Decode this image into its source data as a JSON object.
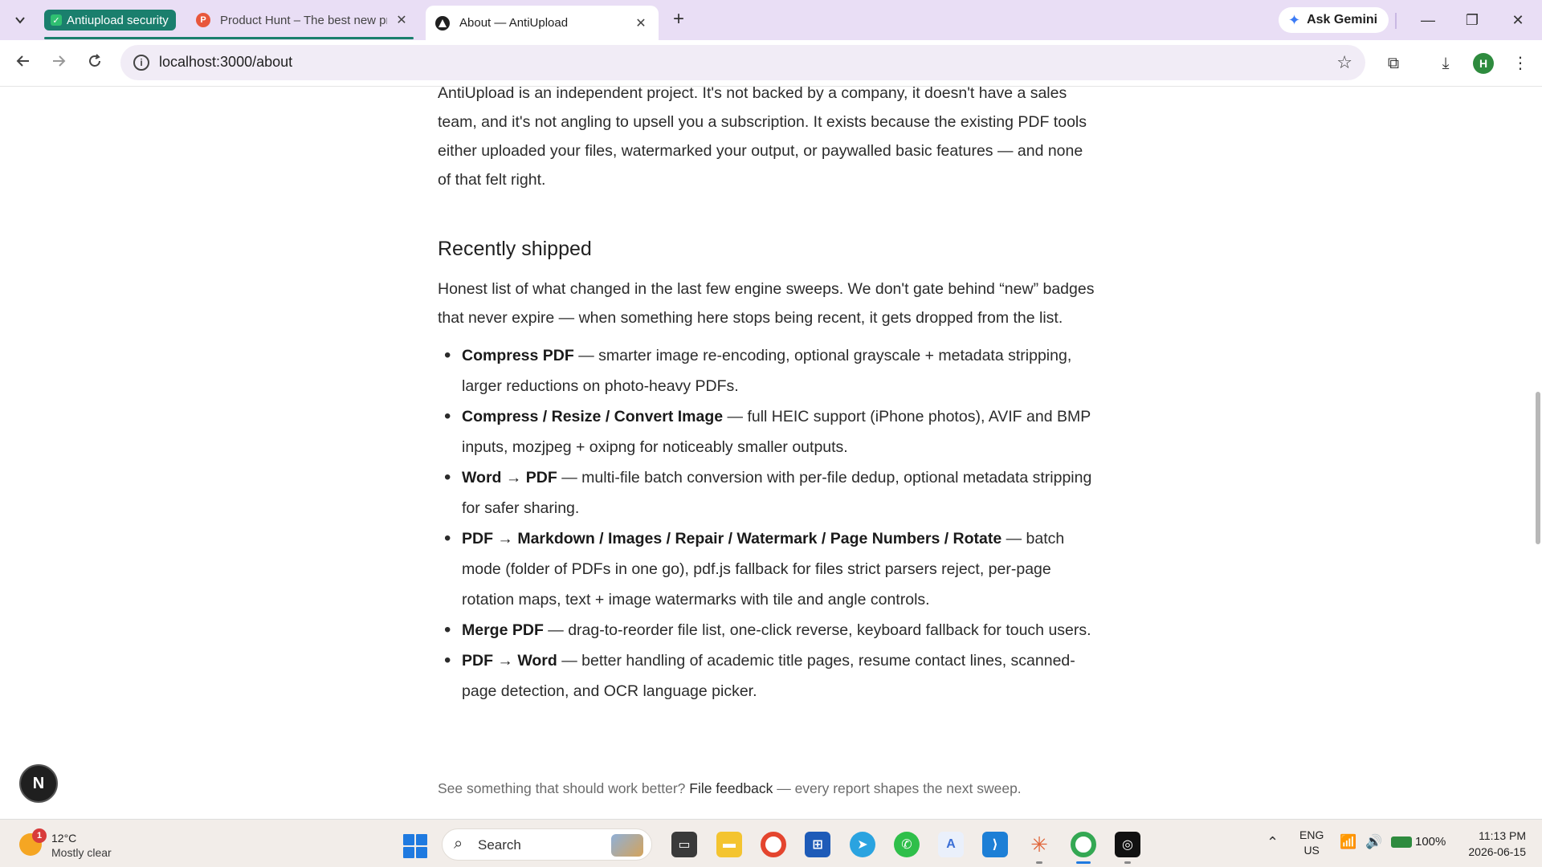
{
  "browser": {
    "tab_group_label": "Antiupload security",
    "tabs": [
      {
        "title": "Product Hunt – The best new products",
        "favicon": "P"
      },
      {
        "title": "About — AntiUpload",
        "active": true
      }
    ],
    "ask_gemini": "Ask Gemini",
    "url": "localhost:3000/about",
    "profile_initial": "H"
  },
  "page": {
    "intro": "AntiUpload is an independent project. It's not backed by a company, it doesn't have a sales team, and it's not angling to upsell you a subscription. It exists because the existing PDF tools either uploaded your files, watermarked your output, or paywalled basic features — and none of that felt right.",
    "section_title": "Recently shipped",
    "section_intro": "Honest list of what changed in the last few engine sweeps. We don't gate behind “new” badges that never expire — when something here stops being recent, it gets dropped from the list.",
    "items": [
      {
        "title": "Compress PDF",
        "desc": " — smarter image re-encoding, optional grayscale + metadata stripping, larger reductions on photo-heavy PDFs."
      },
      {
        "title": "Compress / Resize / Convert Image",
        "desc": " — full HEIC support (iPhone photos), AVIF and BMP inputs, mozjpeg + oxipng for noticeably smaller outputs."
      },
      {
        "title": "Word → PDF",
        "desc": " — multi-file batch conversion with per-file dedup, optional metadata stripping for safer sharing."
      },
      {
        "title": "PDF → Markdown / Images / Repair / Watermark / Page Numbers / Rotate",
        "desc": " — batch mode (folder of PDFs in one go), pdf.js fallback for files strict parsers reject, per-page rotation maps, text + image watermarks with tile and angle controls."
      },
      {
        "title": "Merge PDF",
        "desc": " — drag-to-reorder file list, one-click reverse, keyboard fallback for touch users."
      },
      {
        "title": "PDF → Word",
        "desc": " — better handling of academic title pages, resume contact lines, scanned-page detection, and OCR language picker."
      }
    ],
    "feedback_prefix": "See something that should work better? ",
    "feedback_link": "File feedback",
    "feedback_suffix": " — every report shapes the next sweep.",
    "fab_label": "N"
  },
  "taskbar": {
    "weather_badge": "1",
    "temperature": "12°C",
    "condition": "Mostly clear",
    "search_label": "Search",
    "lang_line1": "ENG",
    "lang_line2": "US",
    "battery": "100%",
    "time": "11:13 PM",
    "date": "2026-06-15"
  }
}
